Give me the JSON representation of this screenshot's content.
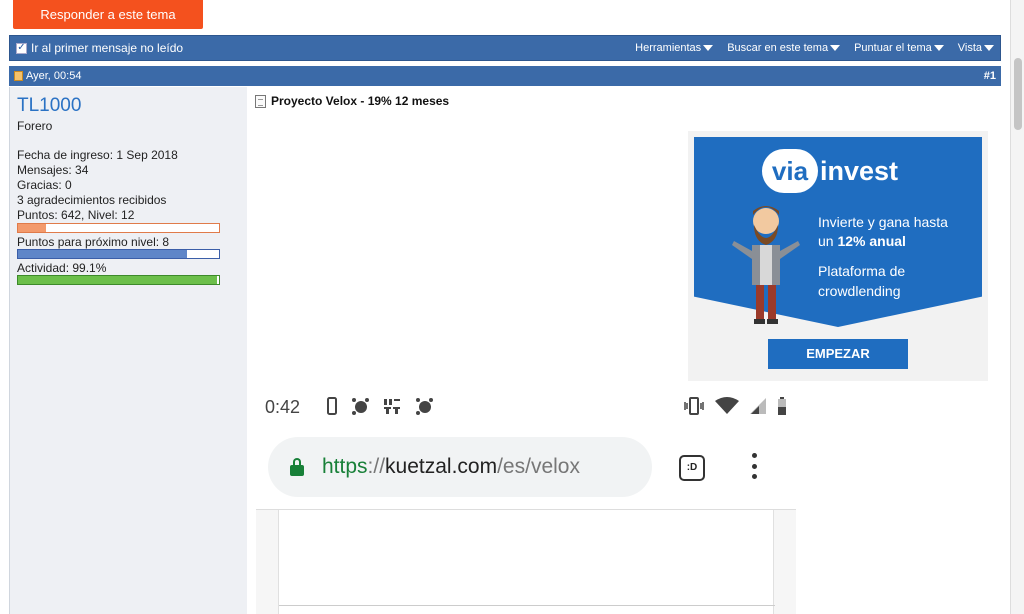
{
  "actions": {
    "reply_label": "Responder a este tema"
  },
  "thread_bar": {
    "first_unread_label": "Ir al primer mensaje no leído",
    "tools": [
      "Herramientas",
      "Buscar en este tema",
      "Puntuar el tema",
      "Vista"
    ]
  },
  "post": {
    "date": "Ayer, 00:54",
    "number": "#1",
    "title": "Proyecto Velox - 19% 12 meses"
  },
  "user": {
    "name": "TL1000",
    "role": "Forero",
    "join_date": "Fecha de ingreso: 1 Sep 2018",
    "messages": "Mensajes: 34",
    "thanks": "Gracias: 0",
    "thanks_received": "3 agradecimientos recibidos",
    "points": "Puntos: 642, Nivel: 12",
    "points_progress": 0.14,
    "next_level_label": "Puntos para próximo nivel: 8",
    "next_level_progress": 0.84,
    "activity_label": "Actividad: 99.1%",
    "activity_progress": 0.991
  },
  "ad": {
    "logo_via": "via",
    "logo_invest": "invest",
    "line1": "Invierte y gana hasta",
    "line2": "un 12% anual",
    "line3": "Plataforma de",
    "line4": "crowdlending",
    "button": "EMPEZAR"
  },
  "phone": {
    "time": "0:42",
    "url_scheme": "https",
    "url_sep": "://",
    "url_domain": "kuetzal.com",
    "url_path": "/es/velox",
    "tab_icon_text": ":D"
  },
  "colors": {
    "accent": "#f4511e",
    "bar_blue": "#3b6aa8",
    "link": "#2a72c4",
    "ad_blue": "#1f6dc0"
  }
}
